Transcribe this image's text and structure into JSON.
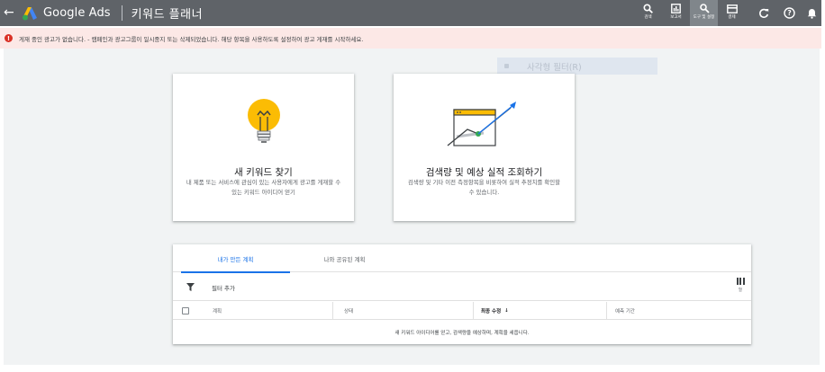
{
  "topbar": {
    "back_icon": "arrow-back-icon",
    "brand": "Google Ads",
    "page_name": "키워드 플래너",
    "tools": [
      {
        "label": "검색",
        "icon": "search-icon"
      },
      {
        "label": "보고서",
        "icon": "reports-icon"
      },
      {
        "label": "도구 및 설정",
        "icon": "tools-wrench-icon",
        "active": true
      },
      {
        "label": "결제",
        "icon": "billing-card-icon"
      }
    ],
    "refresh_icon": "refresh-icon",
    "help_icon": "help-icon",
    "notifications_icon": "bell-icon"
  },
  "alert": {
    "icon": "error-icon",
    "text": "게재 중인 광고가 없습니다. - 캠페인과 광고그룹이 일시중지 또는 삭제되었습니다. 해당 항목을 사용하도록 설정하여 광고 게재를 시작하세요.",
    "color": "#d93025",
    "background": "#fce8e6"
  },
  "ghost_filter": {
    "text": "사각형 필터(R)"
  },
  "cards": [
    {
      "title": "새 키워드 찾기",
      "description": "내 제품 또는 서비스에 관심이 있는 사용자에게 광고를 게재할 수 있는 키워드 아이디어 얻기",
      "illustration": "lightbulb-illustration"
    },
    {
      "title": "검색량 및 예상 실적 조회하기",
      "description": "검색량 및 기타 이전 측정항목을 비롯하여 실적 추정치를 확인할 수 있습니다.",
      "illustration": "forecast-chart-illustration"
    }
  ],
  "plans": {
    "tabs": [
      {
        "label": "내가 만든 계획",
        "active": true
      },
      {
        "label": "나와 공유된 계획",
        "active": false
      }
    ],
    "filter_label": "필터 추가",
    "columns_label": "열",
    "headers": [
      "계획",
      "상태",
      "최종 수정",
      "예측 기간"
    ],
    "sort_indicator": "↓",
    "empty_message": "새 키워드 아이디어를 얻고, 검색량을 예상하며, 계획을 세웁니다."
  },
  "colors": {
    "topbar": "#5f6368",
    "accent_blue": "#1a73e8",
    "bulb_yellow": "#fbbc04",
    "chart_green": "#34a853"
  }
}
